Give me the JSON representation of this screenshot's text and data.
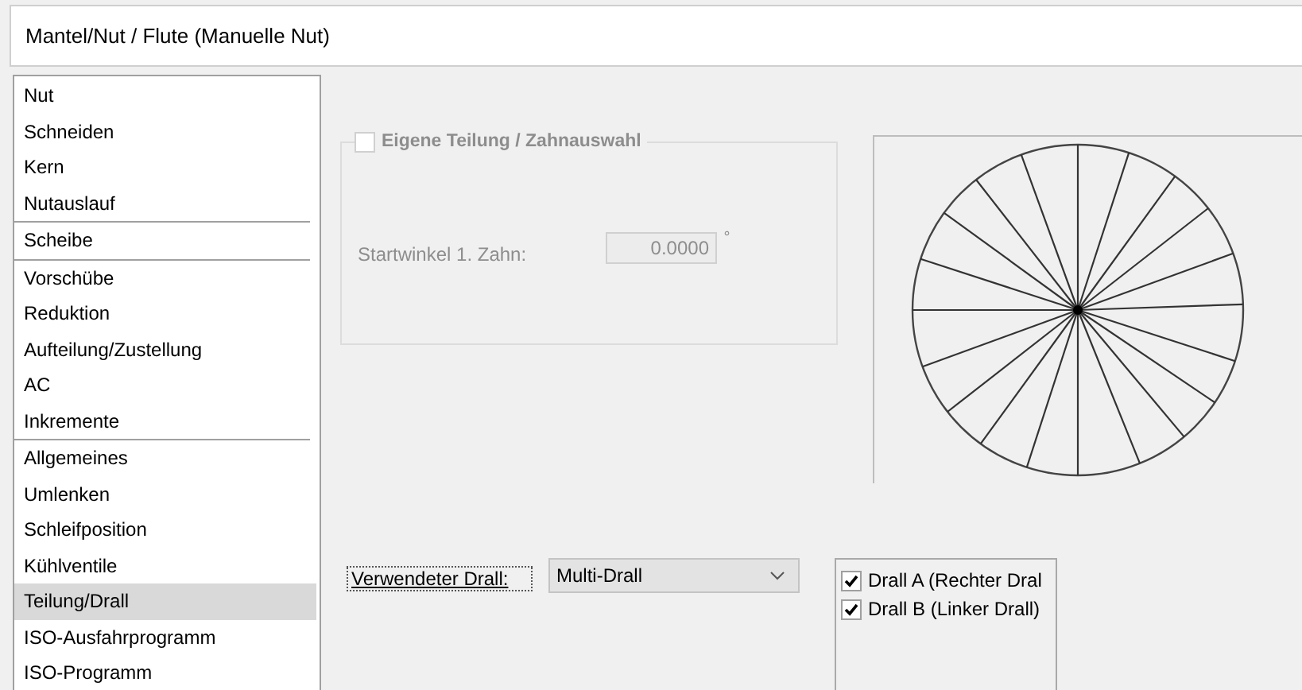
{
  "window": {
    "title": "Mantel/Nut / Flute (Manuelle Nut)"
  },
  "nav": {
    "groups": [
      {
        "items": [
          {
            "label": "Nut",
            "selected": false
          },
          {
            "label": "Schneiden",
            "selected": false
          },
          {
            "label": "Kern",
            "selected": false
          },
          {
            "label": "Nutauslauf",
            "selected": false
          }
        ]
      },
      {
        "items": [
          {
            "label": "Scheibe",
            "selected": false
          }
        ]
      },
      {
        "items": [
          {
            "label": "Vorschübe",
            "selected": false
          },
          {
            "label": "Reduktion",
            "selected": false
          },
          {
            "label": "Aufteilung/Zustellung",
            "selected": false
          },
          {
            "label": "AC",
            "selected": false
          },
          {
            "label": "Inkremente",
            "selected": false
          }
        ]
      },
      {
        "items": [
          {
            "label": "Allgemeines",
            "selected": false
          },
          {
            "label": "Umlenken",
            "selected": false
          },
          {
            "label": "Schleifposition",
            "selected": false
          },
          {
            "label": "Kühlventile",
            "selected": false
          },
          {
            "label": "Teilung/Drall",
            "selected": true
          },
          {
            "label": "ISO-Ausfahrprogramm",
            "selected": false
          },
          {
            "label": "ISO-Programm",
            "selected": false
          }
        ]
      }
    ]
  },
  "division_group": {
    "title": "Eigene Teilung / Zahnauswahl",
    "checked": false,
    "disabled": true,
    "start_angle": {
      "label": "Startwinkel 1. Zahn:",
      "value": "0.0000",
      "unit": "°"
    }
  },
  "twist": {
    "label": "Verwendeter Drall:",
    "value": "Multi-Drall",
    "options": [
      {
        "label": "Drall A (Rechter Dral",
        "checked": true
      },
      {
        "label": "Drall B (Linker Drall)",
        "checked": true
      }
    ]
  }
}
